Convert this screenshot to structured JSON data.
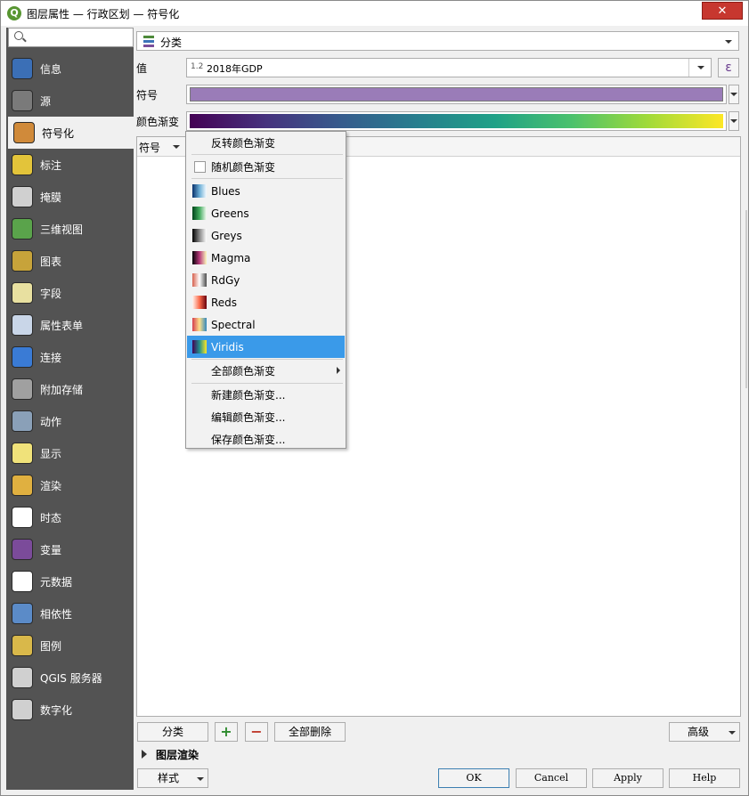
{
  "window": {
    "title": "图层属性 — 行政区划 — 符号化",
    "app_icon_letter": "Q",
    "close_label": "✕"
  },
  "sidebar": {
    "search_placeholder": "",
    "items": [
      {
        "label": "信息",
        "icon": "info-icon",
        "color": "#3b6fb6"
      },
      {
        "label": "源",
        "icon": "source-icon",
        "color": "#7a7a7a"
      },
      {
        "label": "符号化",
        "icon": "symbology-icon",
        "color": "#d08a3a",
        "active": true
      },
      {
        "label": "标注",
        "icon": "label-icon",
        "color": "#e3c43a"
      },
      {
        "label": "掩膜",
        "icon": "mask-icon",
        "color": "#d0d0d0"
      },
      {
        "label": "三维视图",
        "icon": "3d-view-icon",
        "color": "#5aa34b"
      },
      {
        "label": "图表",
        "icon": "diagram-icon",
        "color": "#c7a33a"
      },
      {
        "label": "字段",
        "icon": "fields-icon",
        "color": "#e8e0a0"
      },
      {
        "label": "属性表单",
        "icon": "attribute-form-icon",
        "color": "#c9d6e8"
      },
      {
        "label": "连接",
        "icon": "joins-icon",
        "color": "#3a7bd5"
      },
      {
        "label": "附加存储",
        "icon": "auxiliary-storage-icon",
        "color": "#a0a0a0"
      },
      {
        "label": "动作",
        "icon": "actions-icon",
        "color": "#8aa0b8"
      },
      {
        "label": "显示",
        "icon": "display-icon",
        "color": "#f0e27a"
      },
      {
        "label": "渲染",
        "icon": "rendering-icon",
        "color": "#e0b040"
      },
      {
        "label": "时态",
        "icon": "temporal-icon",
        "color": "#ffffff"
      },
      {
        "label": "变量",
        "icon": "variables-icon",
        "color": "#7b4b9a"
      },
      {
        "label": "元数据",
        "icon": "metadata-icon",
        "color": "#ffffff"
      },
      {
        "label": "相依性",
        "icon": "dependencies-icon",
        "color": "#5b8bc8"
      },
      {
        "label": "图例",
        "icon": "legend-icon",
        "color": "#d9b84a"
      },
      {
        "label": "QGIS 服务器",
        "icon": "qgis-server-icon",
        "color": "#d0d0d0"
      },
      {
        "label": "数字化",
        "icon": "digitizing-icon",
        "color": "#d0d0d0"
      }
    ]
  },
  "renderer": {
    "selected": "分类",
    "icon": "categorized-renderer-icon"
  },
  "form": {
    "value_label": "值",
    "value_prefix": "1.2",
    "value_field": "2018年GDP",
    "expression_button": "ε",
    "symbol_label": "符号",
    "symbol_color": "#9a7cb8",
    "ramp_label": "颜色渐变"
  },
  "table": {
    "header_symbol": "符号"
  },
  "ramp_menu": {
    "invert": "反转颜色渐变",
    "random": "随机颜色渐变",
    "ramps": [
      {
        "name": "Blues",
        "colors": [
          "#08306b",
          "#6baed6",
          "#f7fbff"
        ]
      },
      {
        "name": "Greens",
        "colors": [
          "#00441b",
          "#41ab5d",
          "#f7fcf5"
        ]
      },
      {
        "name": "Greys",
        "colors": [
          "#000000",
          "#888888",
          "#ffffff"
        ]
      },
      {
        "name": "Magma",
        "colors": [
          "#000004",
          "#b73779",
          "#fcfdbf"
        ]
      },
      {
        "name": "RdGy",
        "colors": [
          "#d6604d",
          "#ffffff",
          "#4d4d4d"
        ]
      },
      {
        "name": "Reds",
        "colors": [
          "#fff5f0",
          "#fb6a4a",
          "#67000d"
        ]
      },
      {
        "name": "Spectral",
        "colors": [
          "#d53e4f",
          "#fee08b",
          "#3288bd"
        ]
      },
      {
        "name": "Viridis",
        "colors": [
          "#440154",
          "#21918c",
          "#fde725"
        ],
        "highlighted": true
      }
    ],
    "all_ramps": "全部颜色渐变",
    "new_ramp": "新建颜色渐变...",
    "edit_ramp": "编辑颜色渐变...",
    "save_ramp": "保存颜色渐变..."
  },
  "bottom": {
    "classify": "分类",
    "add": "+",
    "remove": "−",
    "delete_all": "全部删除",
    "advanced": "高级",
    "layer_rendering": "图层渲染",
    "style": "样式",
    "ok": "OK",
    "cancel": "Cancel",
    "apply": "Apply",
    "help": "Help"
  }
}
